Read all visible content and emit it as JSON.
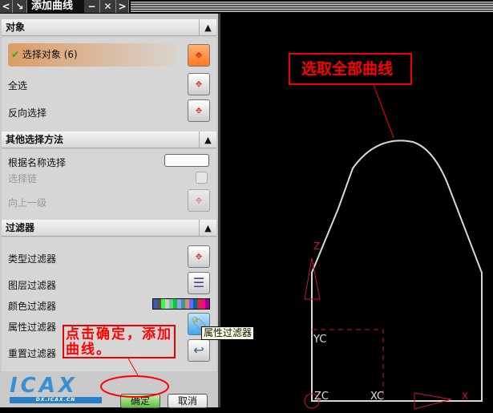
{
  "title": "添加曲线",
  "sections": {
    "object": {
      "header": "对象",
      "select_object": "选择对象 (6)",
      "select_all": "全选",
      "invert": "反向选择"
    },
    "other": {
      "header": "其他选择方法",
      "by_name": "根据名称选择",
      "chain": "选择链",
      "up_level": "向上一级"
    },
    "filter": {
      "header": "过滤器",
      "type": "类型过滤器",
      "layer": "图层过滤器",
      "color": "颜色过滤器",
      "attribute": "属性过滤器",
      "reset": "重置过滤器"
    }
  },
  "tooltip": "属性过滤器",
  "buttons": {
    "ok": "确定",
    "cancel": "取消"
  },
  "logo": {
    "text": "ICAX",
    "url": "DX.ICAX.CN"
  },
  "annotations": {
    "select_all_curves": "选取全部曲线",
    "click_ok": "点击确定，添加曲线。"
  },
  "viewport": {
    "labels": {
      "z": "Z",
      "yc": "YC",
      "zc": "ZC",
      "xc": "XC",
      "x": "X"
    }
  },
  "colors": {
    "accent": "#e00000",
    "curve": "#d8d8d8",
    "swatches": [
      "#3c5ab4",
      "#555",
      "#3f3",
      "#ccc",
      "#6c9",
      "#0c3",
      "#99f",
      "#399",
      "#d87",
      "#66f",
      "#069",
      "#c33",
      "#f08",
      "#909"
    ]
  }
}
